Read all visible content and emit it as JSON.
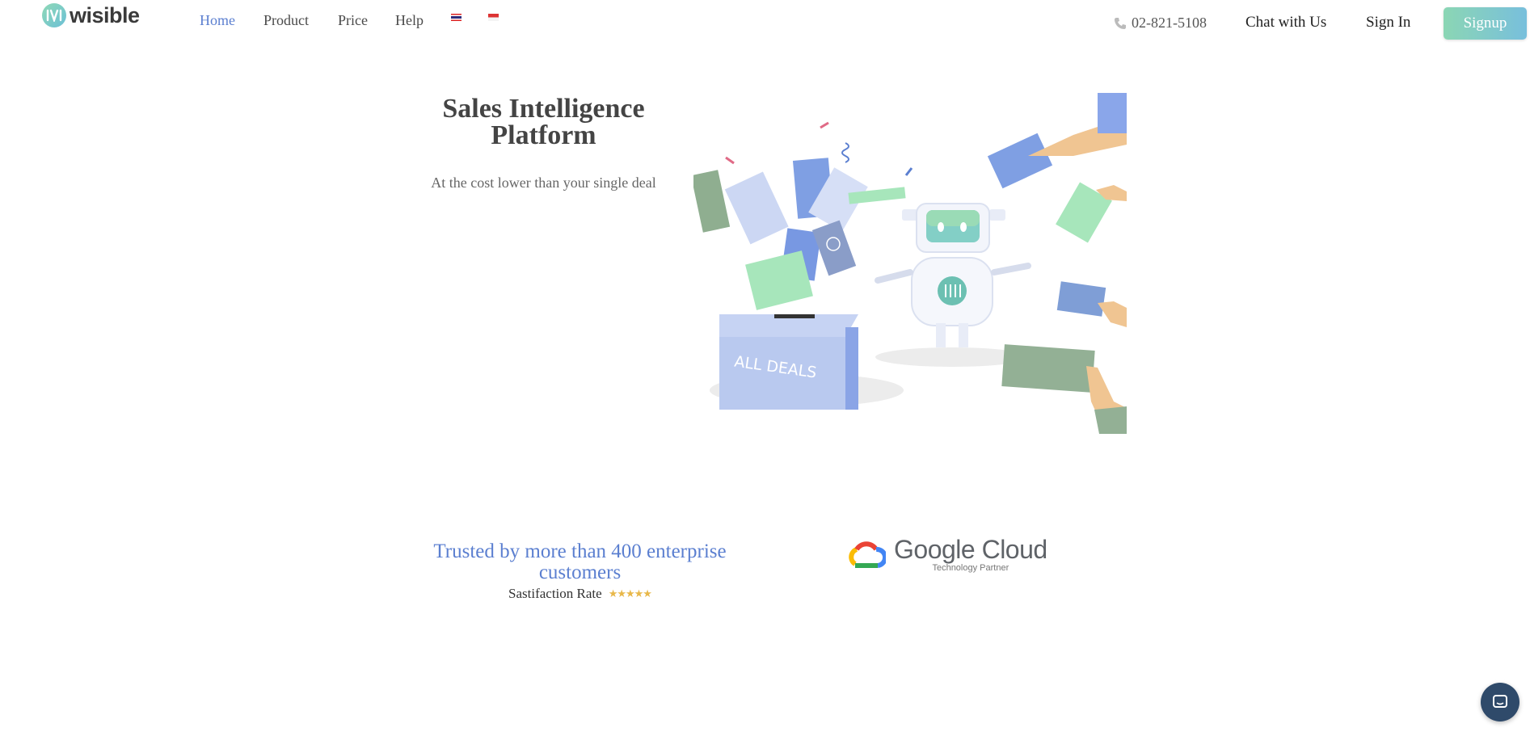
{
  "brand": {
    "name": "wisible",
    "accent": "#5b7fd0",
    "gradient_start": "#8bd6b4",
    "gradient_end": "#78bfdc"
  },
  "nav": {
    "links": [
      {
        "label": "Home",
        "active": true
      },
      {
        "label": "Product",
        "active": false
      },
      {
        "label": "Price",
        "active": false
      },
      {
        "label": "Help",
        "active": false
      }
    ],
    "flags": [
      "thai-flag-icon",
      "indonesia-flag-icon"
    ],
    "phone": "02-821-5108",
    "chat": "Chat with Us",
    "signin": "Sign In",
    "signup": "Signup"
  },
  "hero": {
    "title_line1": "Sales Intelligence",
    "title_line2": "Platform",
    "subtitle": "At the cost lower than your single deal",
    "box_label": "ALL DEALS"
  },
  "trust": {
    "title": "Trusted by more than 400 enterprise customers",
    "rate_label": "Sastifaction Rate",
    "stars": "★★★★★",
    "partner_name": "Google Cloud",
    "partner_sub": "Technology Partner"
  }
}
